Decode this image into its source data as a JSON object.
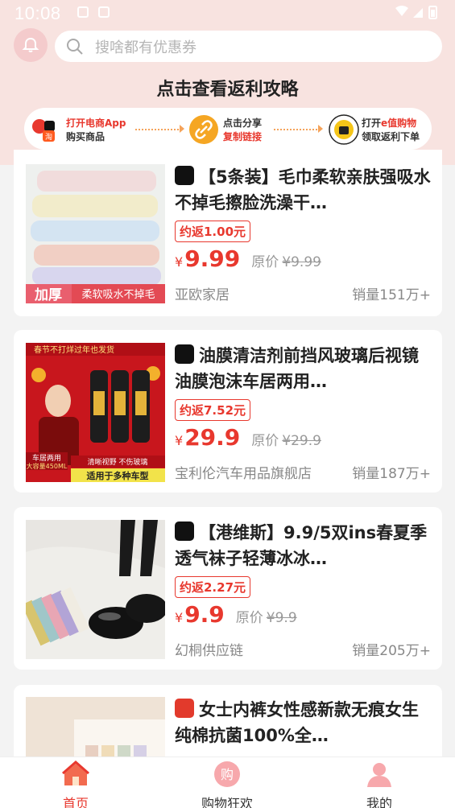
{
  "status": {
    "time": "10:08"
  },
  "search": {
    "placeholder": "搜啥都有优惠券"
  },
  "strategy": {
    "title": "点击查看返利攻略",
    "step1": {
      "line1": "打开电商App",
      "line2": "购买商品"
    },
    "step2": {
      "line1": "点击分享",
      "line2": "复制链接"
    },
    "step3": {
      "line1_a": "打开",
      "line1_b": "e值购物",
      "line2": "领取返利下单"
    }
  },
  "products": [
    {
      "platform": "douyin",
      "title": "【5条装】毛巾柔软亲肤强吸水不掉毛擦脸洗澡干…",
      "rebate": "约返1.00元",
      "price": "9.99",
      "original_label": "原价",
      "original_price": "¥9.99",
      "shop": "亚欧家居",
      "sales": "销量151万+",
      "thumb_tags": [
        "加厚",
        "柔软吸水不掉毛"
      ]
    },
    {
      "platform": "douyin",
      "title": "油膜清洁剂前挡风玻璃后视镜油膜泡沫车居两用…",
      "rebate": "约返7.52元",
      "price": "29.9",
      "original_label": "原价",
      "original_price": "¥29.9",
      "shop": "宝利伦汽车用品旗舰店",
      "sales": "销量187万+",
      "thumb_tags": [
        "春节不打烊过年也发货",
        "车居两用",
        "大容量450ML",
        "清晰视野  不伤玻璃",
        "适用于多种车型"
      ]
    },
    {
      "platform": "douyin",
      "title": "【港维斯】9.9/5双ins春夏季透气袜子轻薄冰冰…",
      "rebate": "约返2.27元",
      "price": "9.9",
      "original_label": "原价",
      "original_price": "¥9.9",
      "shop": "幻桐供应链",
      "sales": "销量205万+",
      "thumb_tags": []
    },
    {
      "platform": "tmall",
      "title": "女士内裤女性感新款无痕女生纯棉抗菌100%全…",
      "rebate": "",
      "price": "",
      "original_label": "",
      "original_price": "",
      "shop": "",
      "sales": "",
      "thumb_tags": []
    }
  ],
  "tabs": [
    {
      "label": "首页",
      "active": true
    },
    {
      "label": "购物狂欢",
      "active": false
    },
    {
      "label": "我的",
      "active": false
    }
  ],
  "colors": {
    "accent": "#e8382e",
    "header_bg": "#f8e3e0",
    "tab_active": "#e8382e"
  }
}
